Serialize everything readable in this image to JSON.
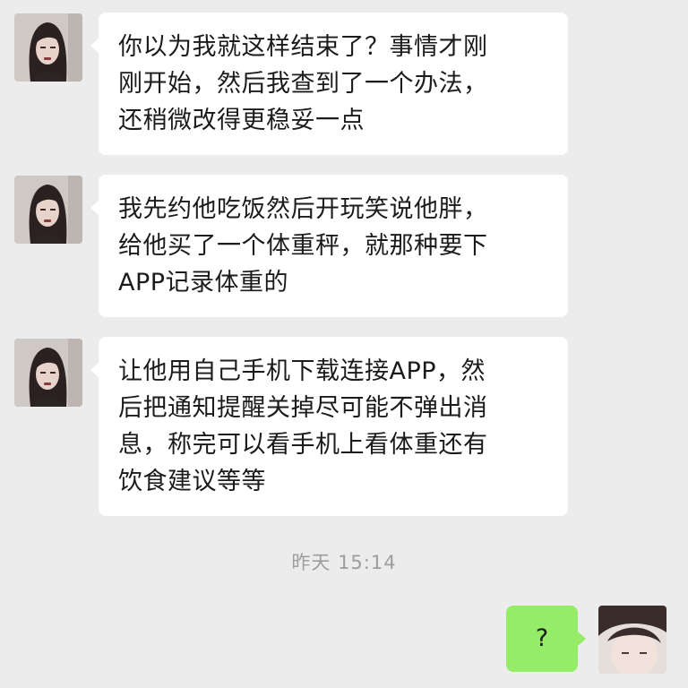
{
  "messages": [
    {
      "sender": "other",
      "lines": [
        "你以为我就这样结束了？事情才刚",
        "刚开始，然后我查到了一个办法，",
        "还稍微改得更稳妥一点"
      ]
    },
    {
      "sender": "other",
      "lines": [
        "我先约他吃饭然后开玩笑说他胖，",
        "给他买了一个体重秤，就那种要下",
        "APP记录体重的"
      ]
    },
    {
      "sender": "other",
      "lines": [
        "让他用自己手机下载连接APP，然",
        "后把通知提醒关掉尽可能不弹出消",
        "息，称完可以看手机上看体重还有",
        "饮食建议等等"
      ]
    }
  ],
  "timestamp": "昨天 15:14",
  "reply": {
    "sender": "self",
    "text": "?"
  },
  "colors": {
    "background": "#ececec",
    "incoming_bubble": "#ffffff",
    "outgoing_bubble": "#95ec69",
    "timestamp": "#9d9d9d"
  }
}
